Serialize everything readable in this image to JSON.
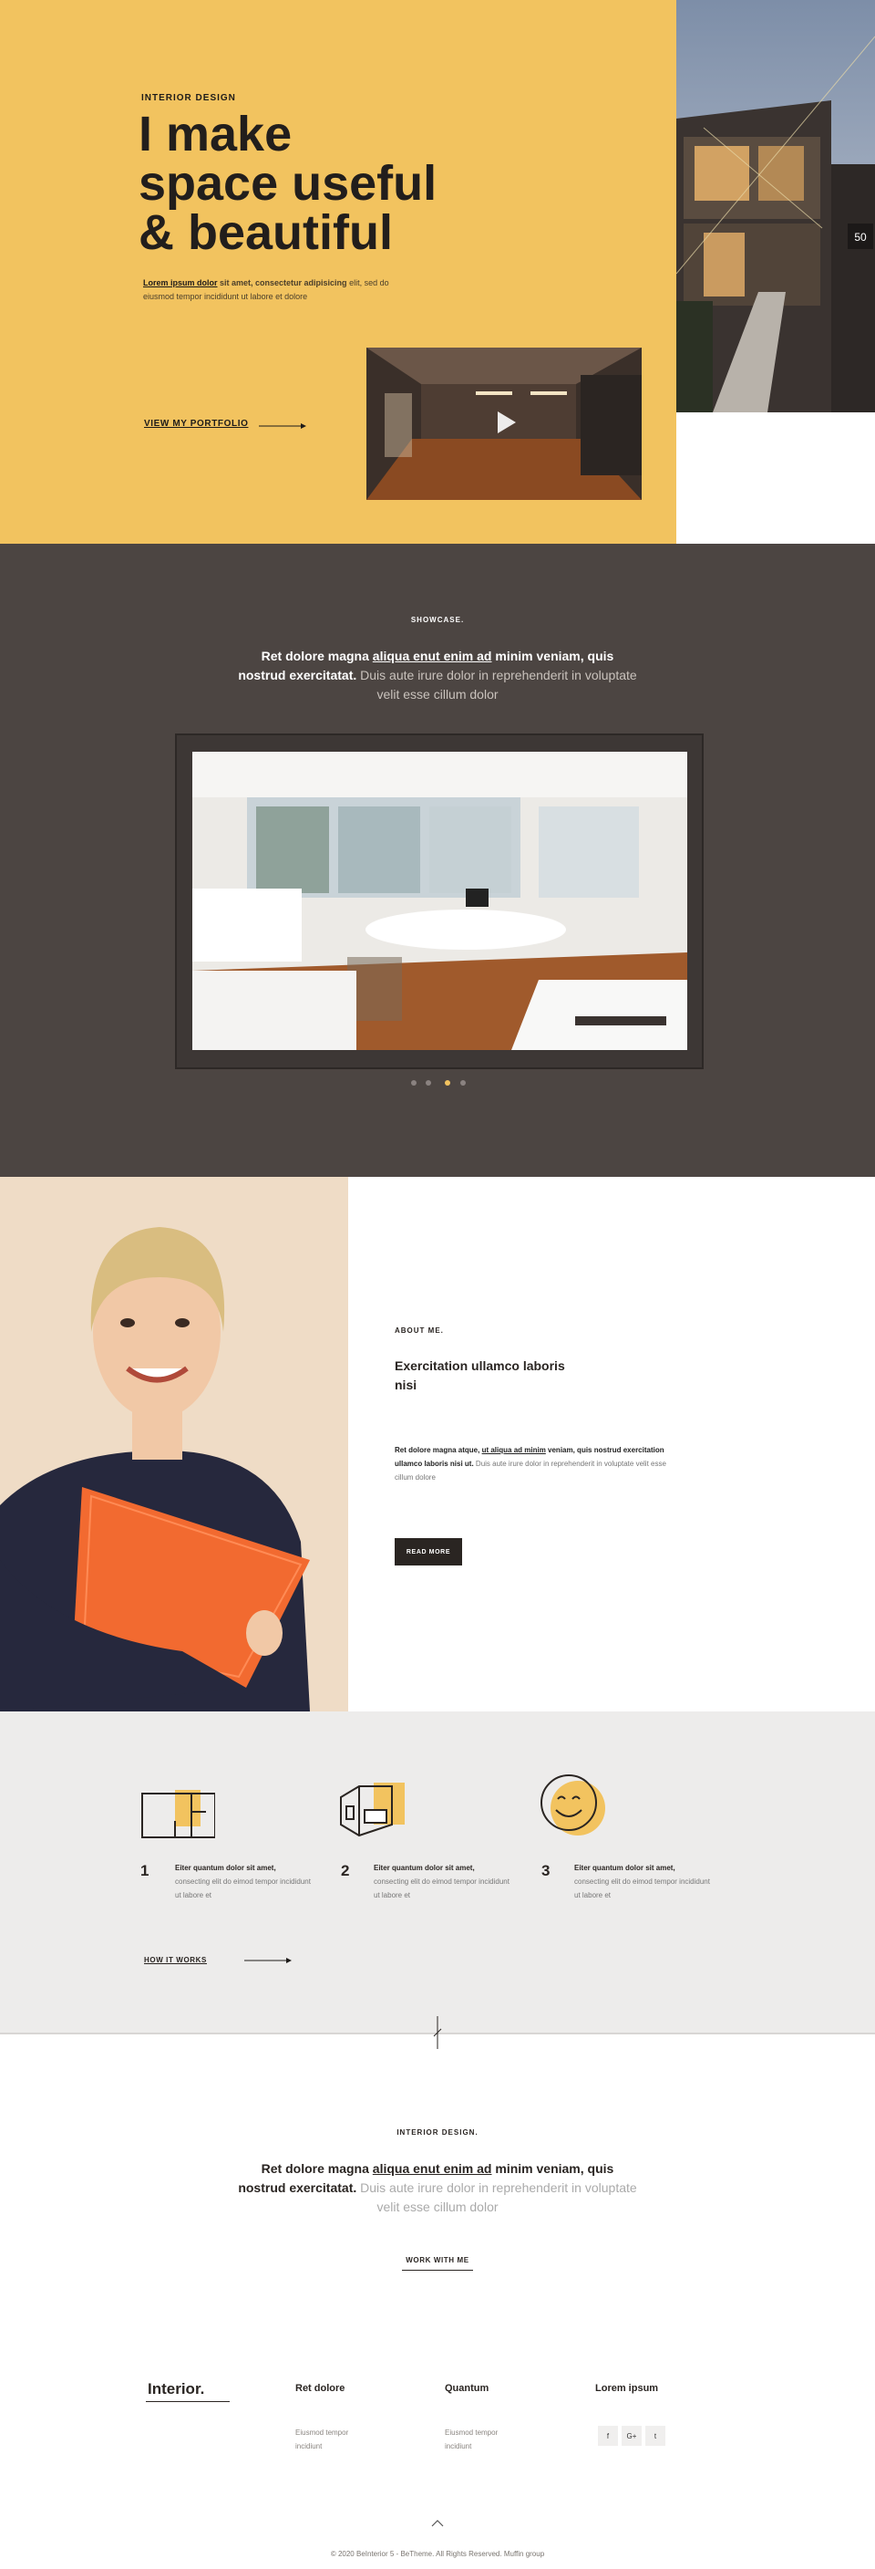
{
  "colors": {
    "accent": "#f2c35f",
    "dark": "#4c4542",
    "light_bg": "#edeceb",
    "text": "#2a2522"
  },
  "hero": {
    "eyebrow": "INTERIOR DESIGN",
    "title_lines": [
      "I make",
      "space useful",
      "& beautiful"
    ],
    "desc_bold": "Lorem ipsum dolor",
    "desc_bold2": " sit amet, consectetur adipisicing",
    "desc_rest": "elit, sed do eiusmod tempor incididunt ut labore et dolore",
    "link": "VIEW MY PORTFOLIO",
    "photo_sign": "50"
  },
  "showcase": {
    "eyebrow": "SHOWCASE.",
    "strong1": "Ret dolore magna ",
    "link": "aliqua enut enim ad",
    "strong2": " minim veniam, quis nostrud exercitatat.",
    "muted": " Duis aute irure dolor in reprehenderit in voluptate velit esse cillum dolor",
    "slides": 4,
    "active_slide": 3
  },
  "about": {
    "eyebrow": "ABOUT ME.",
    "title": "Exercitation ullamco laboris nisi",
    "text_bold": "Ret dolore magna atque, ",
    "text_link": "ut aliqua ad minim",
    "text_bold2": " veniam, quis nostrud exercitation ullamco laboris nisi ut.",
    "text_muted": " Duis aute irure dolor in reprehenderit in voluptate velit esse cillum dolore",
    "button": "READ MORE"
  },
  "steps": {
    "items": [
      {
        "num": "1",
        "title": "Eiter quantum dolor sit amet,",
        "text": "consecting elit do eimod tempor incididunt ut labore et"
      },
      {
        "num": "2",
        "title": "Eiter quantum dolor sit amet,",
        "text": "consecting elit do eimod tempor incididunt ut labore et"
      },
      {
        "num": "3",
        "title": "Eiter quantum dolor sit amet,",
        "text": "consecting elit do eimod tempor incididunt ut labore et"
      }
    ],
    "link": "HOW IT WORKS"
  },
  "cta": {
    "eyebrow": "INTERIOR DESIGN.",
    "strong1": "Ret dolore magna ",
    "link": "aliqua enut enim ad",
    "strong2": " minim veniam, quis nostrud exercitatat.",
    "muted": " Duis aute irure dolor in reprehenderit in voluptate velit esse cillum dolor",
    "button": "WORK WITH ME"
  },
  "footer": {
    "logo": "Interior.",
    "col1": {
      "title": "Ret dolore",
      "links": [
        "Eiusmod tempor",
        "incidiunt"
      ]
    },
    "col2": {
      "title": "Quantum",
      "links": [
        "Eiusmod tempor",
        "incidiunt"
      ]
    },
    "col3": {
      "title": "Lorem ipsum",
      "social": [
        "f",
        "G+",
        "t"
      ]
    },
    "copyright": "© 2020 BeInterior 5 - BeTheme. All Rights Reserved. Muffin group"
  }
}
